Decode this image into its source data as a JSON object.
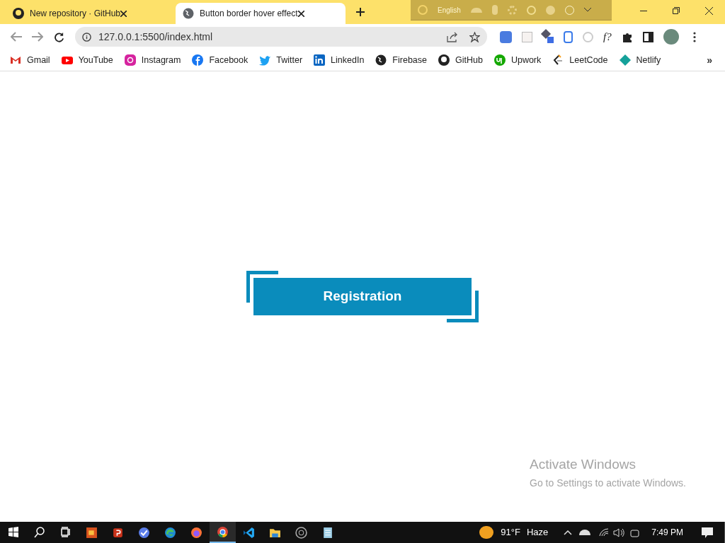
{
  "tabs": [
    {
      "title": "New repository · GitHub",
      "selected": false
    },
    {
      "title": "Button border hover effect",
      "selected": true
    }
  ],
  "language_bar": {
    "language": "English"
  },
  "address_bar": {
    "url": "127.0.0.1:5500/index.html"
  },
  "extension_text": "f?",
  "bookmarks": [
    {
      "label": "Gmail"
    },
    {
      "label": "YouTube"
    },
    {
      "label": "Instagram"
    },
    {
      "label": "Facebook"
    },
    {
      "label": "Twitter"
    },
    {
      "label": "LinkedIn"
    },
    {
      "label": "Firebase"
    },
    {
      "label": "GitHub"
    },
    {
      "label": "Upwork"
    },
    {
      "label": "LeetCode"
    },
    {
      "label": "Netlify"
    }
  ],
  "bookmarks_more": "»",
  "page": {
    "button": "Registration"
  },
  "activation_notice": {
    "title": "Activate Windows",
    "text": "Go to Settings to activate Windows."
  },
  "taskbar": {
    "apps": [
      {
        "active": false
      },
      {
        "active": false
      },
      {
        "active": false
      },
      {
        "active": false
      },
      {
        "active": false
      },
      {
        "active": true
      },
      {
        "active": false
      },
      {
        "active": false
      },
      {
        "active": false
      },
      {
        "active": false
      }
    ],
    "weather": {
      "temperature": "91°F",
      "condition": "Haze"
    },
    "time": "7:49 PM"
  }
}
